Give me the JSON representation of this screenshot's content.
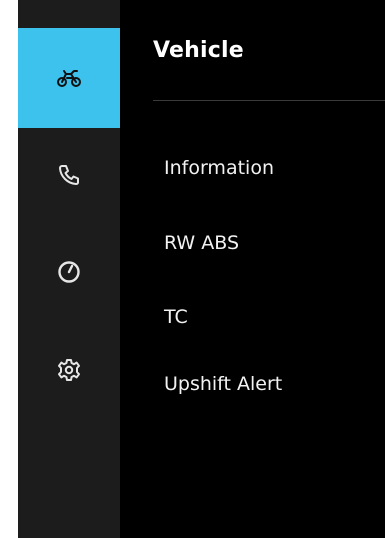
{
  "colors": {
    "accent": "#3cc2ec",
    "rail_bg": "#1c1c1c",
    "content_bg": "#000000",
    "text": "#f2f2f2"
  },
  "rail": {
    "items": [
      {
        "name": "vehicle",
        "icon": "motorcycle-icon",
        "active": true
      },
      {
        "name": "phone",
        "icon": "phone-icon",
        "active": false
      },
      {
        "name": "trip",
        "icon": "gauge-icon",
        "active": false
      },
      {
        "name": "settings",
        "icon": "gear-icon",
        "active": false
      }
    ]
  },
  "main": {
    "title": "Vehicle",
    "menu": [
      {
        "label": "Information"
      },
      {
        "label": "RW ABS"
      },
      {
        "label": "TC"
      },
      {
        "label": "Upshift Alert"
      }
    ]
  }
}
